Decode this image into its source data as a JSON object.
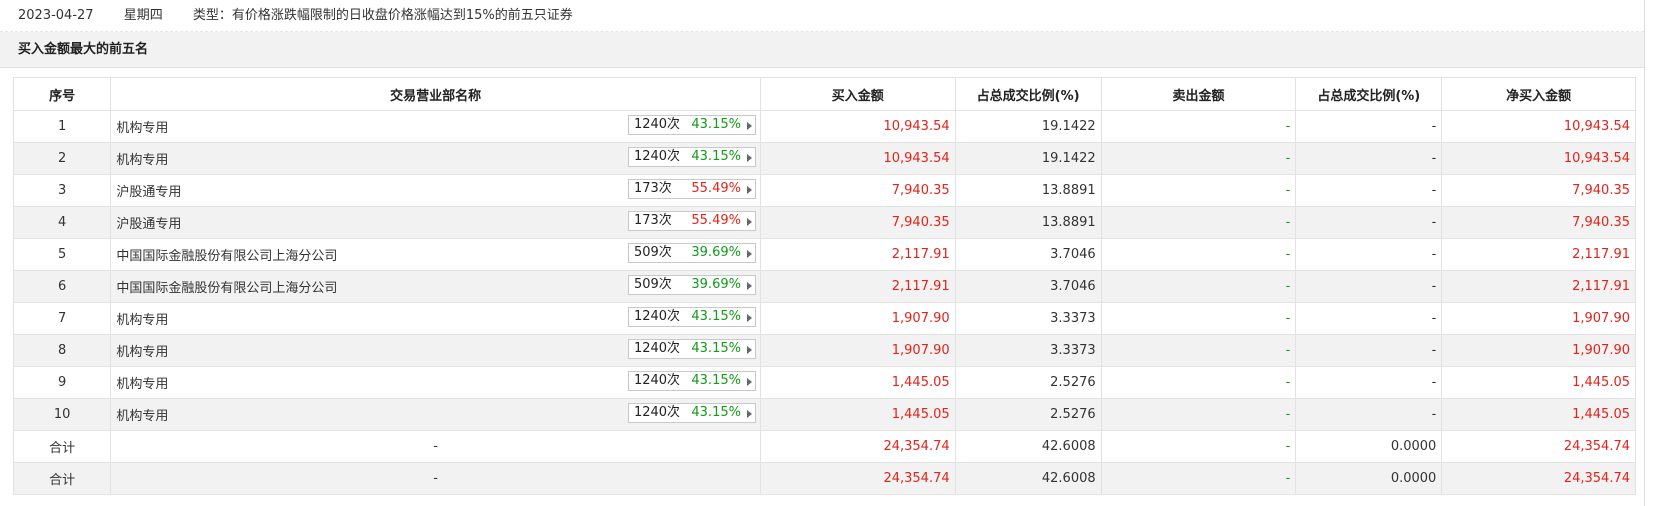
{
  "header": {
    "date": "2023-04-27",
    "weekday": "星期四",
    "type": "类型：有价格涨跌幅限制的日收盘价格涨幅达到15%的前五只证券"
  },
  "section_title": "买入金额最大的前五名",
  "columns": [
    "序号",
    "交易营业部名称",
    "买入金额",
    "占总成交比例(%)",
    "卖出金额",
    "占总成交比例(%)",
    "净买入金额"
  ],
  "rows": [
    {
      "no": "1",
      "name": "机构专用",
      "count": "1240次",
      "pct": "43.15%",
      "pct_color": "green",
      "buy": "10,943.54",
      "buy_ratio": "19.1422",
      "sell": "-",
      "sell_ratio": "-",
      "net": "10,943.54"
    },
    {
      "no": "2",
      "name": "机构专用",
      "count": "1240次",
      "pct": "43.15%",
      "pct_color": "green",
      "buy": "10,943.54",
      "buy_ratio": "19.1422",
      "sell": "-",
      "sell_ratio": "-",
      "net": "10,943.54"
    },
    {
      "no": "3",
      "name": "沪股通专用",
      "count": "173次",
      "pct": "55.49%",
      "pct_color": "red",
      "buy": "7,940.35",
      "buy_ratio": "13.8891",
      "sell": "-",
      "sell_ratio": "-",
      "net": "7,940.35"
    },
    {
      "no": "4",
      "name": "沪股通专用",
      "count": "173次",
      "pct": "55.49%",
      "pct_color": "red",
      "buy": "7,940.35",
      "buy_ratio": "13.8891",
      "sell": "-",
      "sell_ratio": "-",
      "net": "7,940.35"
    },
    {
      "no": "5",
      "name": "中国国际金融股份有限公司上海分公司",
      "count": "509次",
      "pct": "39.69%",
      "pct_color": "green",
      "buy": "2,117.91",
      "buy_ratio": "3.7046",
      "sell": "-",
      "sell_ratio": "-",
      "net": "2,117.91"
    },
    {
      "no": "6",
      "name": "中国国际金融股份有限公司上海分公司",
      "count": "509次",
      "pct": "39.69%",
      "pct_color": "green",
      "buy": "2,117.91",
      "buy_ratio": "3.7046",
      "sell": "-",
      "sell_ratio": "-",
      "net": "2,117.91"
    },
    {
      "no": "7",
      "name": "机构专用",
      "count": "1240次",
      "pct": "43.15%",
      "pct_color": "green",
      "buy": "1,907.90",
      "buy_ratio": "3.3373",
      "sell": "-",
      "sell_ratio": "-",
      "net": "1,907.90"
    },
    {
      "no": "8",
      "name": "机构专用",
      "count": "1240次",
      "pct": "43.15%",
      "pct_color": "green",
      "buy": "1,907.90",
      "buy_ratio": "3.3373",
      "sell": "-",
      "sell_ratio": "-",
      "net": "1,907.90"
    },
    {
      "no": "9",
      "name": "机构专用",
      "count": "1240次",
      "pct": "43.15%",
      "pct_color": "green",
      "buy": "1,445.05",
      "buy_ratio": "2.5276",
      "sell": "-",
      "sell_ratio": "-",
      "net": "1,445.05"
    },
    {
      "no": "10",
      "name": "机构专用",
      "count": "1240次",
      "pct": "43.15%",
      "pct_color": "green",
      "buy": "1,445.05",
      "buy_ratio": "2.5276",
      "sell": "-",
      "sell_ratio": "-",
      "net": "1,445.05"
    }
  ],
  "totals": [
    {
      "label": "合计",
      "name": "-",
      "buy": "24,354.74",
      "buy_ratio": "42.6008",
      "sell": "-",
      "sell_ratio": "0.0000",
      "net": "24,354.74"
    },
    {
      "label": "合计",
      "name": "-",
      "buy": "24,354.74",
      "buy_ratio": "42.6008",
      "sell": "-",
      "sell_ratio": "0.0000",
      "net": "24,354.74"
    }
  ],
  "colors": {
    "red": "#e3231a",
    "green": "#119a19"
  }
}
